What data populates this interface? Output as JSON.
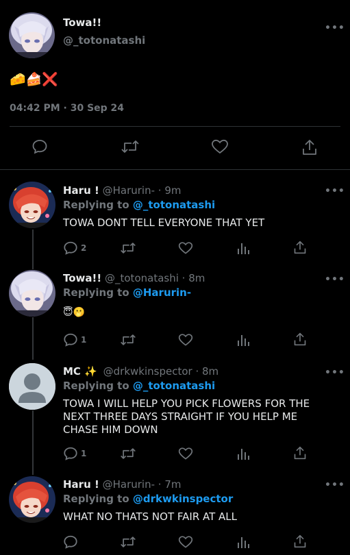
{
  "main_tweet": {
    "display_name": "Towa!!",
    "handle": "@_totonatashi",
    "body": "🧀🍰❌",
    "time": "04:42 PM",
    "date": "30 Sep 24"
  },
  "replies": [
    {
      "display_name": "Haru !",
      "handle": "@Harurin-",
      "time": "9m",
      "replying_label": "Replying to",
      "replying_to": "@_totonatashi",
      "body": "TOWA DONT TELL EVERYONE THAT YET",
      "reply_count": "2",
      "avatar": "red-hair-avatar"
    },
    {
      "display_name": "Towa!!",
      "handle": "@_totonatashi",
      "time": "8m",
      "replying_label": "Replying to",
      "replying_to": "@Harurin-",
      "body": "😇🫢",
      "reply_count": "1",
      "avatar": "white-hair-avatar"
    },
    {
      "display_name": "MC ✨",
      "handle": "@drkwkinspector",
      "time": "8m",
      "replying_label": "Replying to",
      "replying_to": "@_totonatashi",
      "body_lines": [
        "TOWA I WILL HELP YOU PICK FLOWERS FOR THE",
        "NEXT THREE DAYS STRAIGHT IF YOU HELP ME",
        "CHASE HIM DOWN"
      ],
      "reply_count": "1",
      "avatar": "default-avatar"
    },
    {
      "display_name": "Haru !",
      "handle": "@Harurin-",
      "time": "7m",
      "replying_label": "Replying to",
      "replying_to": "@drkwkinspector",
      "body": "WHAT NO THATS NOT FAIR AT ALL",
      "reply_count": "",
      "avatar": "red-hair-avatar"
    }
  ],
  "separator": "·",
  "more_glyph": "•••",
  "colors": {
    "background": "#000000",
    "text": "#e7e9ea",
    "muted": "#71767b",
    "accent": "#1d9bf0"
  }
}
